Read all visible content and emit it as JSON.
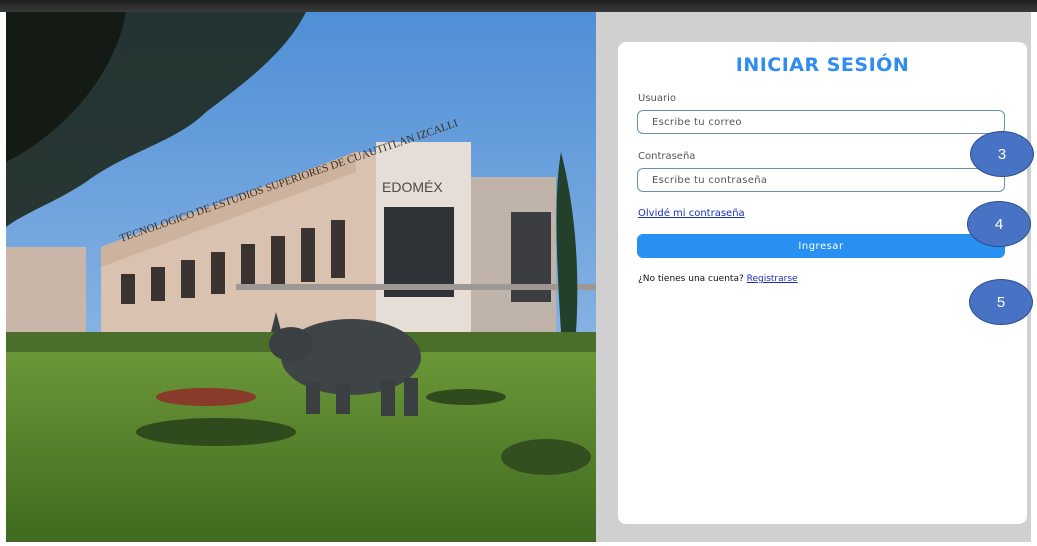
{
  "login": {
    "title": "INICIAR SESIÓN",
    "username_label": "Usuario",
    "username_placeholder": "Escribe tu correo",
    "password_label": "Contraseña",
    "password_placeholder": "Escribe tu contraseña",
    "forgot_link": "Olvidé mi contraseña",
    "submit_label": "Ingresar",
    "signup_prompt": "¿No tienes una cuenta?",
    "signup_link": "Registrarse"
  },
  "annotations": [
    {
      "label": "3"
    },
    {
      "label": "4"
    },
    {
      "label": "5"
    }
  ],
  "background_photo": {
    "subject": "campus building with rhinoceros statue",
    "building_sign": "TECNOLOGICO DE ESTUDIOS SUPERIORES DE CUAUTITLAN IZCALLI",
    "logo": "EDOMÉX"
  },
  "colors": {
    "accent": "#2f8cf0",
    "button": "#2790f0",
    "link": "#1a2fbf",
    "panel_bg": "#d0d0d0",
    "marker": "#4872c4"
  }
}
